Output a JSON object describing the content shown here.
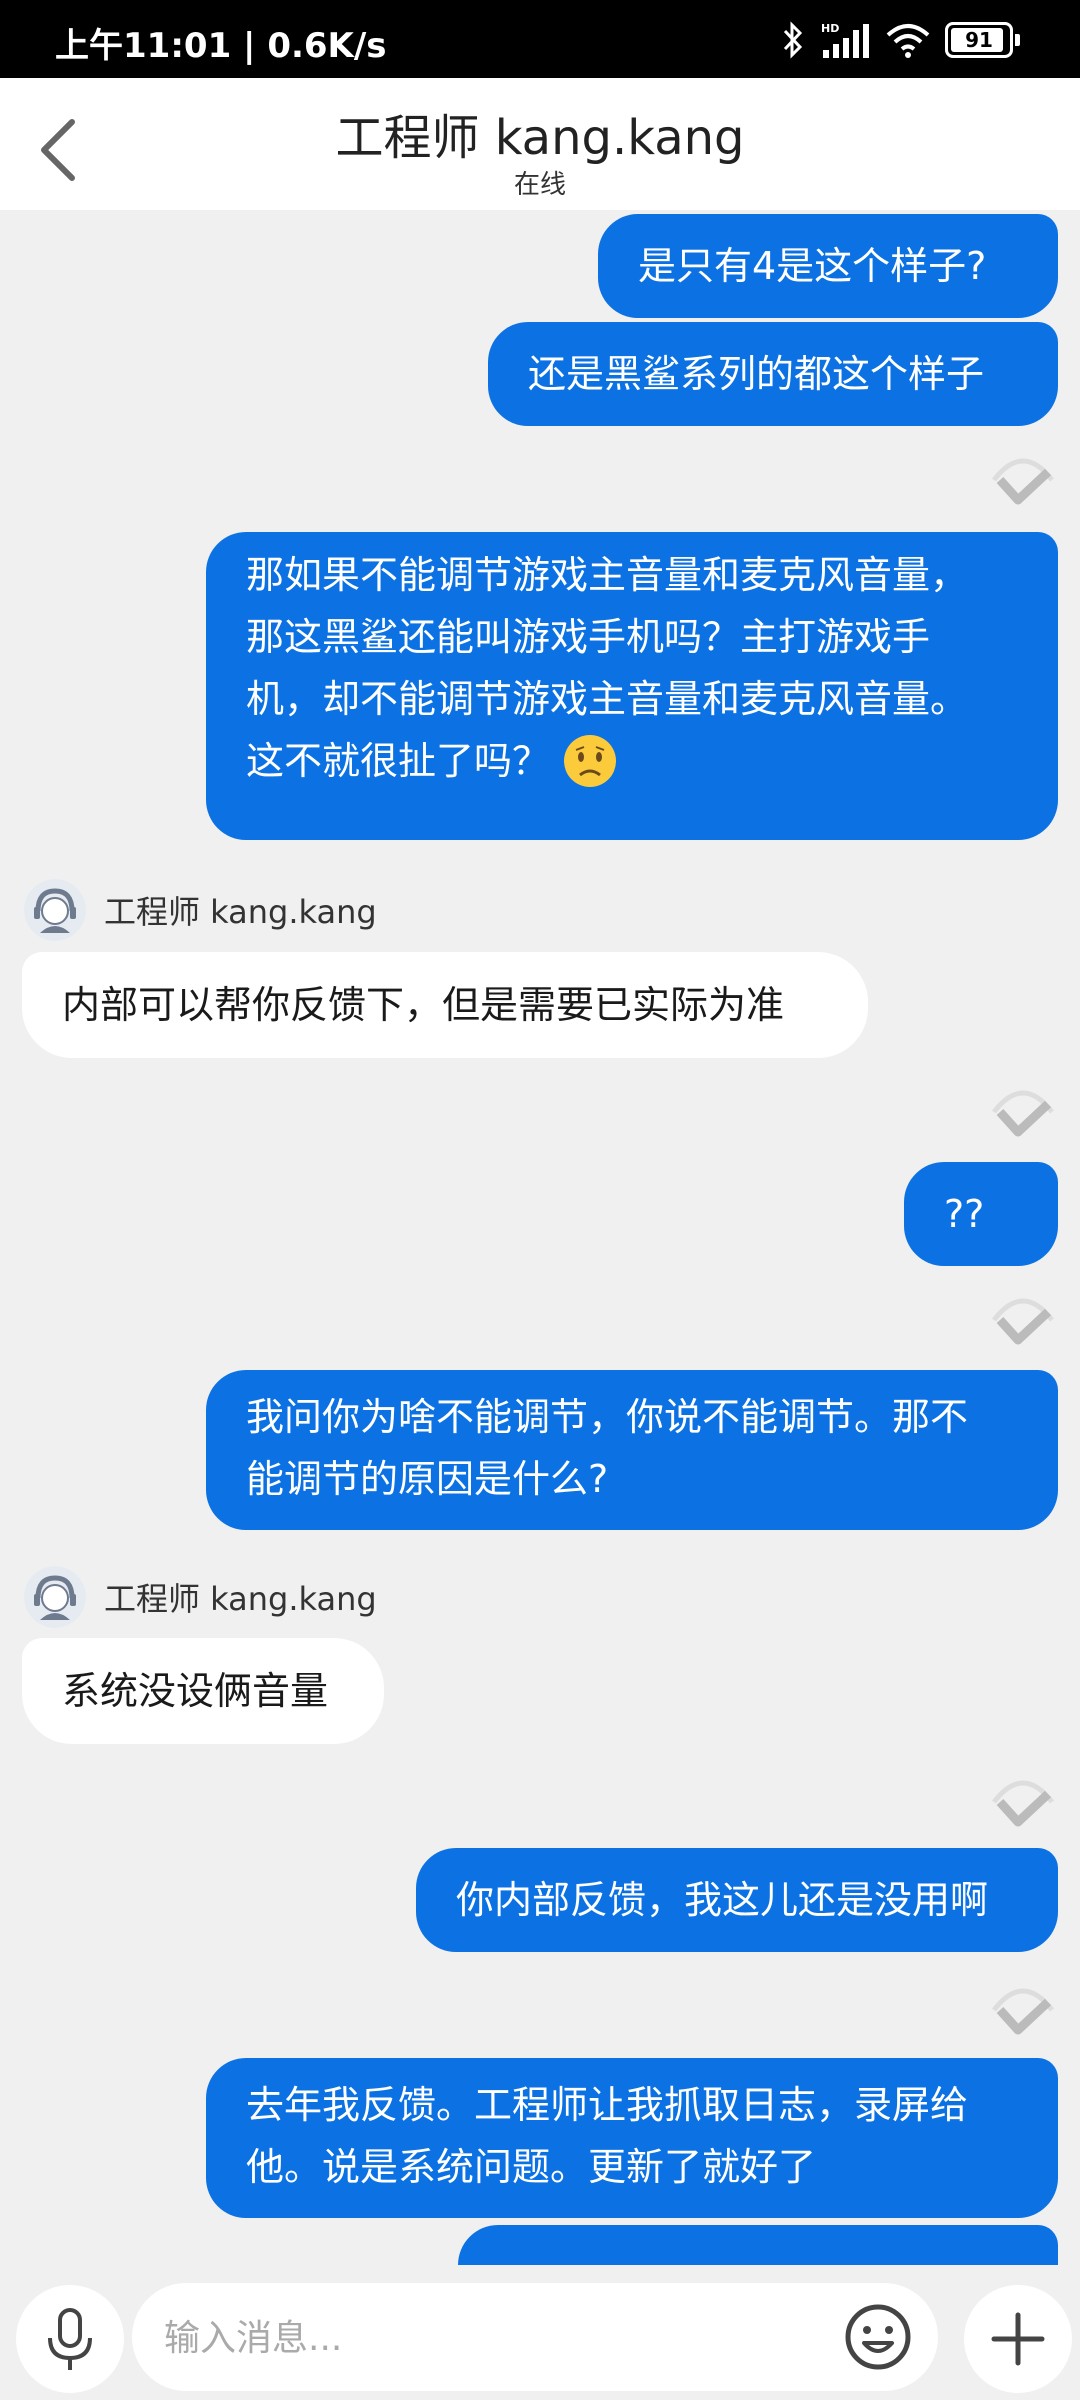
{
  "status_bar": {
    "time": "上午11:01 | 0.6K/s",
    "battery": "91",
    "icons": [
      "bluetooth-icon",
      "hd-signal-icon",
      "wifi-icon",
      "battery-icon"
    ]
  },
  "header": {
    "title": "工程师 kang.kang",
    "status": "在线"
  },
  "messages": [
    {
      "from": "me",
      "text": "是只有4是这个样子?"
    },
    {
      "from": "me",
      "text": "还是黑鲨系列的都这个样子"
    },
    {
      "from": "me",
      "lines": [
        "那如果不能调节游戏主音量和麦克风音量，",
        "那这黑鲨还能叫游戏手机吗？主打游戏手",
        "机，却不能调节游戏主音量和麦克风音量。",
        "这不就很扯了吗？"
      ]
    },
    {
      "from": "them",
      "sender": "工程师 kang.kang",
      "text": "内部可以帮你反馈下，但是需要已实际为准"
    },
    {
      "from": "me",
      "text": "??"
    },
    {
      "from": "me",
      "lines": [
        "我问你为啥不能调节，你说不能调节。那不",
        "能调节的原因是什么?"
      ]
    },
    {
      "from": "them",
      "sender": "工程师 kang.kang",
      "text": "系统没设俩音量"
    },
    {
      "from": "me",
      "text": "你内部反馈，我这儿还是没用啊"
    },
    {
      "from": "me",
      "lines": [
        "去年我反馈。工程师让我抓取日志，录屏给",
        "他。说是系统问题。更新了就好了"
      ]
    }
  ],
  "input": {
    "placeholder": "输入消息..."
  },
  "colors": {
    "my_bubble": "#0c72e3",
    "their_bubble": "#ffffff",
    "background": "#f0f0f0"
  }
}
